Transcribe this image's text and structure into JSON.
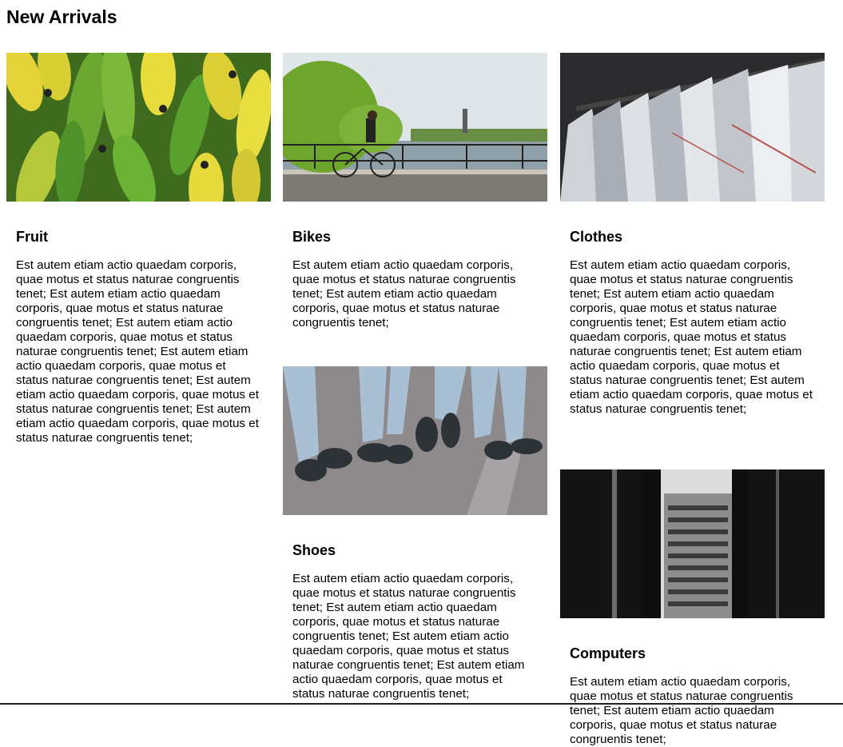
{
  "page": {
    "title": "New Arrivals"
  },
  "cards": [
    {
      "title": "Fruit",
      "image": "bananas-photo",
      "text": "Est autem etiam actio quaedam corporis, quae motus et status naturae congruentis tenet; Est autem etiam actio quaedam corporis, quae motus et status naturae congruentis tenet; Est autem etiam actio quaedam corporis, quae motus et status naturae congruentis tenet; Est autem etiam actio quaedam corporis, quae motus et status naturae congruentis tenet; Est autem etiam actio quaedam corporis, quae motus et status naturae congruentis tenet; Est autem etiam actio quaedam corporis, quae motus et status naturae congruentis tenet;"
    },
    {
      "title": "Bikes",
      "image": "cyclist-bridge-photo",
      "text": "Est autem etiam actio quaedam corporis, quae motus et status naturae congruentis tenet; Est autem etiam actio quaedam corporis, quae motus et status naturae congruentis tenet;"
    },
    {
      "title": "Clothes",
      "image": "shirts-rack-photo",
      "text": "Est autem etiam actio quaedam corporis, quae motus et status naturae congruentis tenet; Est autem etiam actio quaedam corporis, quae motus et status naturae congruentis tenet; Est autem etiam actio quaedam corporis, quae motus et status naturae congruentis tenet; Est autem etiam actio quaedam corporis, quae motus et status naturae congruentis tenet; Est autem etiam actio quaedam corporis, quae motus et status naturae congruentis tenet;"
    },
    {
      "title": "Shoes",
      "image": "sneakers-photo",
      "text": "Est autem etiam actio quaedam corporis, quae motus et status naturae congruentis tenet; Est autem etiam actio quaedam corporis, quae motus et status naturae congruentis tenet; Est autem etiam actio quaedam corporis, quae motus et status naturae congruentis tenet; Est autem etiam actio quaedam corporis, quae motus et status naturae congruentis tenet;"
    },
    {
      "title": "Computers",
      "image": "ibm-building-photo",
      "text": "Est autem etiam actio quaedam corporis, quae motus et status naturae congruentis tenet; Est autem etiam actio quaedam corporis, quae motus et status naturae congruentis tenet;"
    }
  ],
  "colors": {
    "banana-green": "#5c9e2e",
    "banana-yellow": "#e4d43a",
    "sky": "#dfe6ea",
    "shirt-grey": "#b9bec6",
    "jeans": "#a9c0d4",
    "building-dark": "#141414"
  }
}
